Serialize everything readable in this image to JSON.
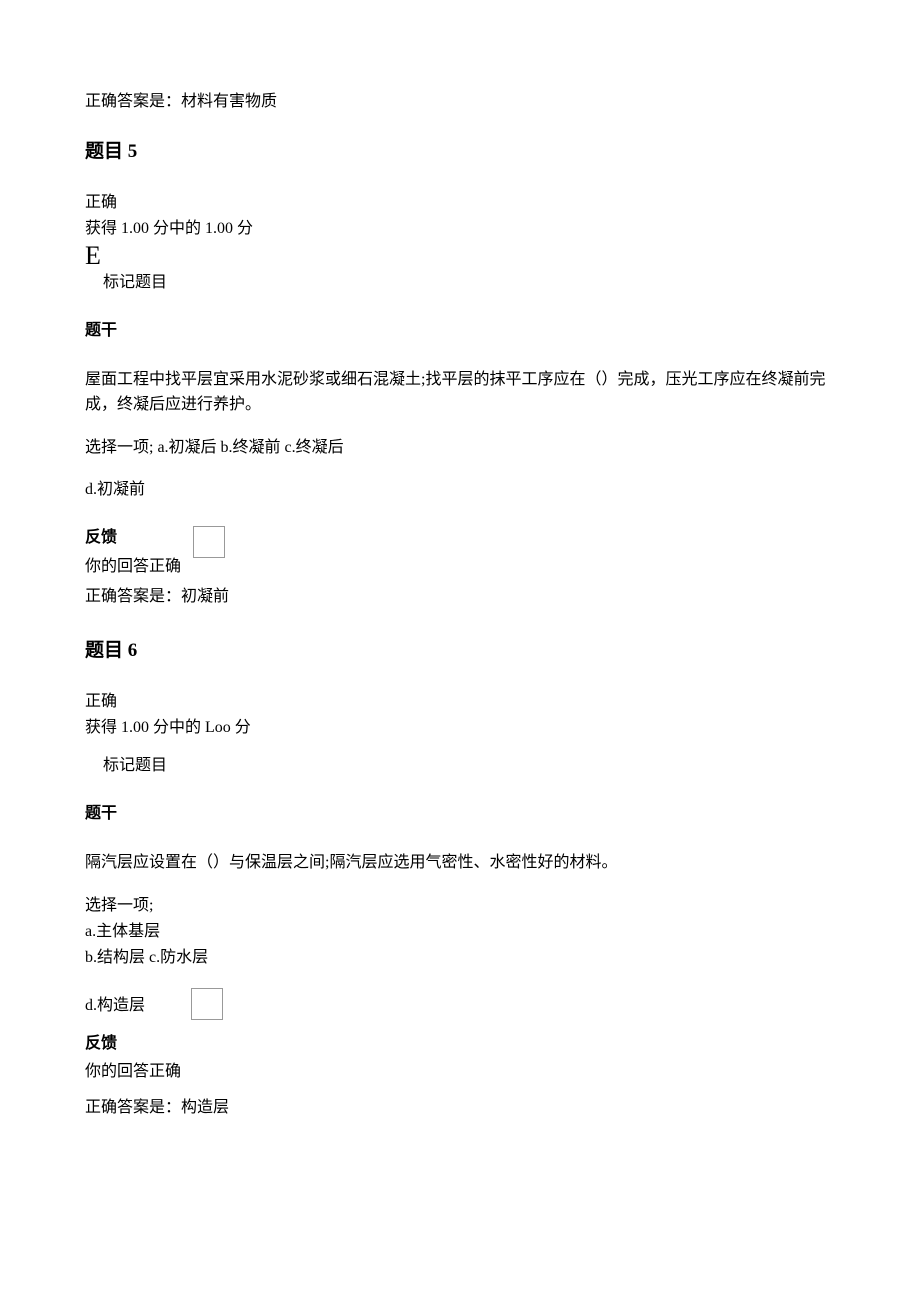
{
  "prev_answer": "正确答案是：材料有害物质",
  "q5": {
    "heading": "题目 5",
    "status": "正确",
    "score": "获得 1.00 分中的 1.00 分",
    "e_mark": "E",
    "mark_label": "标记题目",
    "stem_heading": "题干",
    "question_text": "屋面工程中找平层宜采用水泥砂浆或细石混凝土;找平层的抹平工序应在（）完成，压光工序应在终凝前完成，终凝后应进行养护。",
    "options_line": "选择一项; a.初凝后 b.终凝前 c.终凝后",
    "option_d": "d.初凝前",
    "feedback_heading": "反馈",
    "feedback_text": "你的回答正确",
    "correct_answer": "正确答案是：初凝前"
  },
  "q6": {
    "heading": "题目 6",
    "status": "正确",
    "score": "获得 1.00 分中的 Loo 分",
    "mark_label": "标记题目",
    "stem_heading": "题干",
    "question_text": "隔汽层应设置在（）与保温层之间;隔汽层应选用气密性、水密性好的材料。",
    "select_label": "选择一项;",
    "option_a": "a.主体基层",
    "option_bc": "b.结构层 c.防水层",
    "option_d": "d.构造层",
    "feedback_heading": "反馈",
    "feedback_text": "你的回答正确",
    "correct_answer": "正确答案是：构造层"
  }
}
